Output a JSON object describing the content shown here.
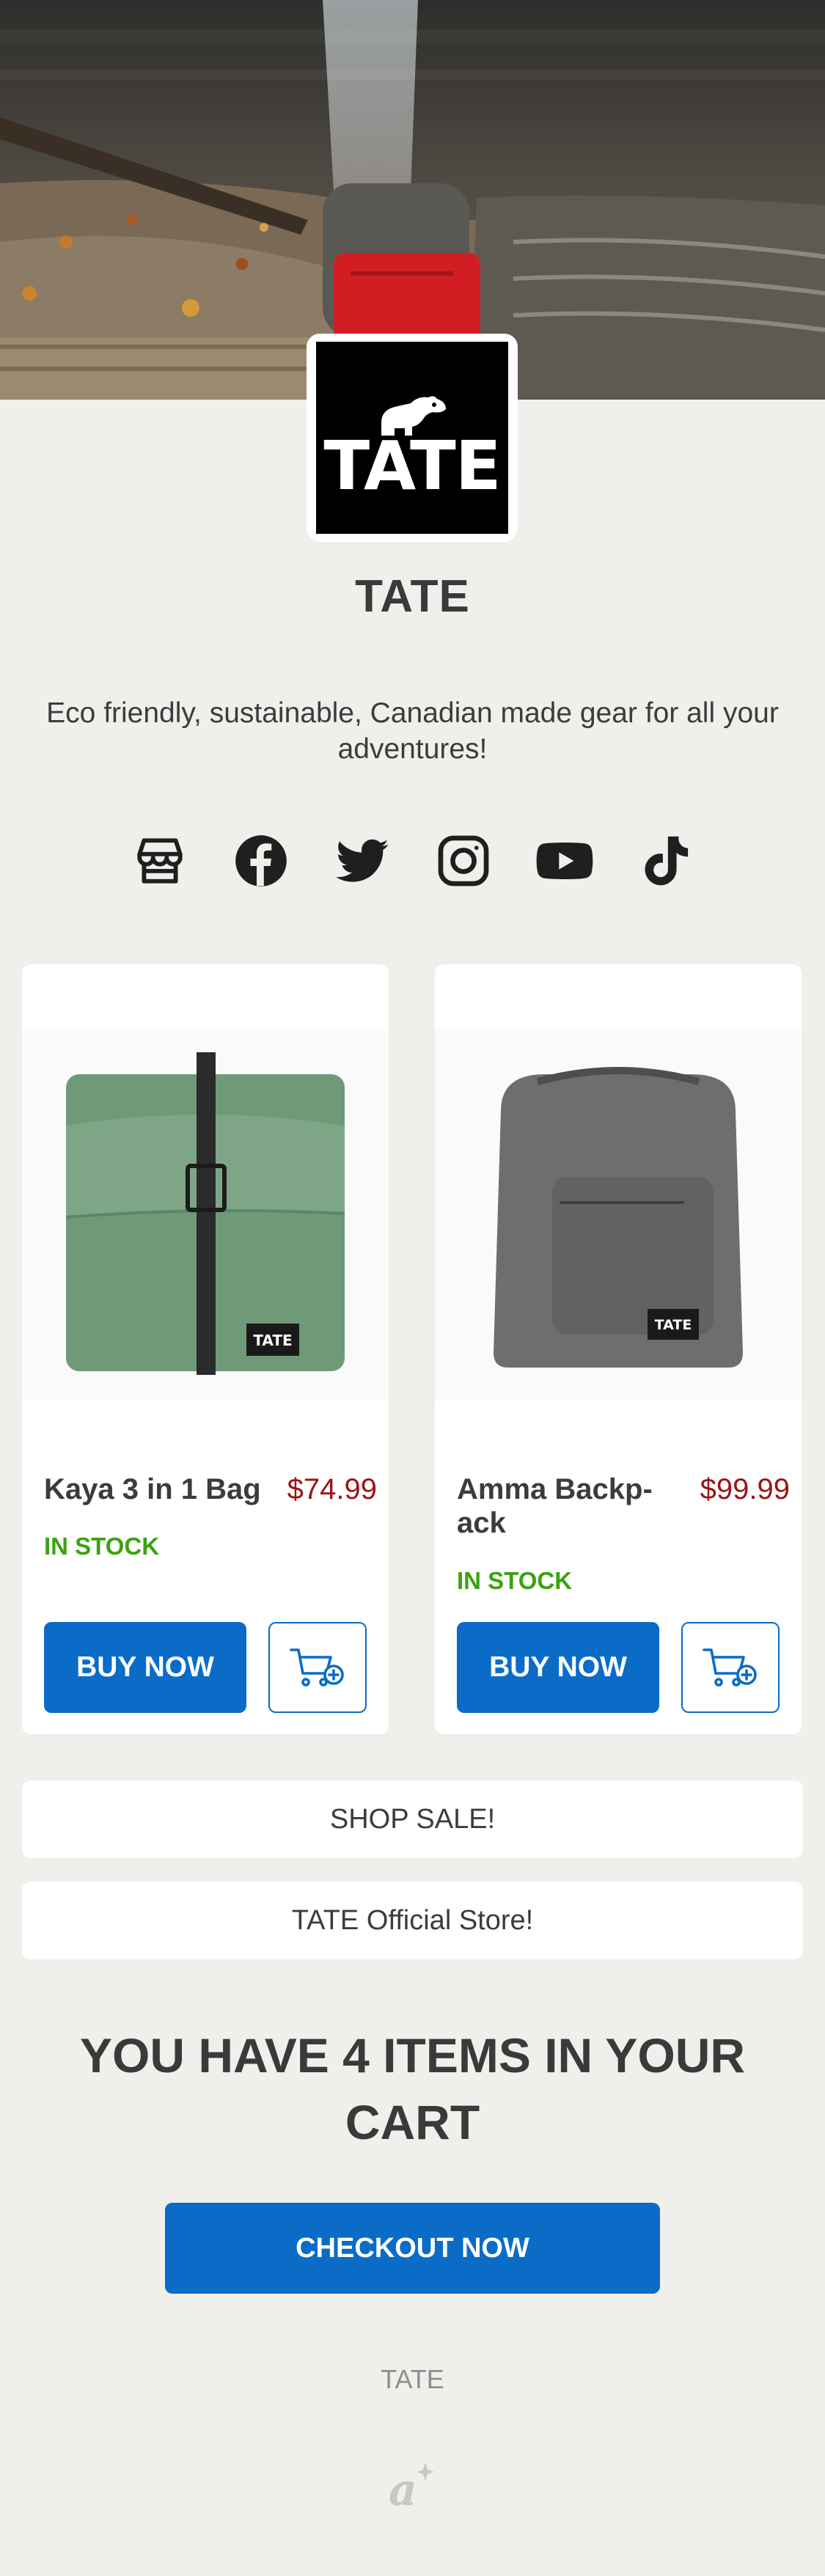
{
  "brand": {
    "name": "TATE",
    "logo_text": "TATE",
    "tagline": "Eco friendly, sustainable, Canadian made gear for all your adventures!"
  },
  "socials": [
    {
      "icon": "store-icon"
    },
    {
      "icon": "facebook-icon"
    },
    {
      "icon": "twitter-icon"
    },
    {
      "icon": "instagram-icon"
    },
    {
      "icon": "youtube-icon"
    },
    {
      "icon": "tiktok-icon"
    }
  ],
  "products": [
    {
      "name": "Kaya 3 in 1 Bag",
      "price": "$74.99",
      "stock": "IN STOCK",
      "buy_label": "BUY NOW",
      "tag": "TATE",
      "color": "#6f9a78"
    },
    {
      "name": "Amma Backp-\nack",
      "price": "$99.99",
      "stock": "IN STOCK",
      "buy_label": "BUY NOW",
      "tag": "TATE",
      "color": "#6e6e6e"
    }
  ],
  "links": {
    "shop_sale": "SHOP SALE!",
    "official_store": "TATE Official Store!"
  },
  "cart": {
    "heading": "YOU HAVE 4 ITEMS IN YOUR CART",
    "checkout_label": "CHECKOUT NOW"
  },
  "footer": {
    "brand": "TATE"
  },
  "colors": {
    "accent": "#0a6cc7",
    "price": "#9b1414",
    "in_stock": "#3aa30f",
    "background": "#f0efec"
  }
}
